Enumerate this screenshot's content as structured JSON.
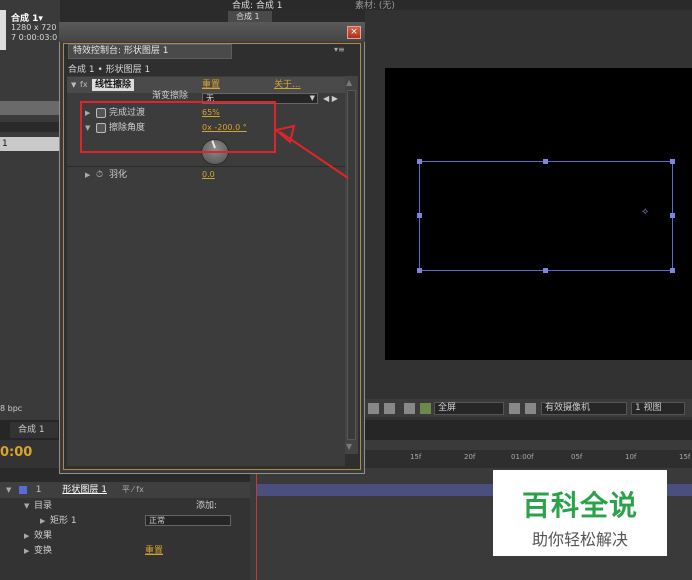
{
  "project": {
    "comp_name": "合成 1▾",
    "comp_size": "1280 x 720",
    "comp_duration": "7 0:00:03:0",
    "list_row": "1",
    "bpc": "8 bpc"
  },
  "composition": {
    "tab_label": "合成: 合成 1",
    "tab_label_2": "素材: (无)",
    "subtab": "合成 1",
    "toolbar": {
      "resolution": "全屏",
      "camera": "有效摄像机",
      "views": "1 视图"
    }
  },
  "effects_panel": {
    "close": "×",
    "tab_title": "特效控制台: 形状图层 1",
    "menu": "▾≡",
    "breadcrumb": "合成 1 • 形状图层 1",
    "effect_name": "线性擦除",
    "reset": "重置",
    "about": "关于...",
    "wipe_label": "渐变擦除",
    "wipe_value": "无",
    "params": [
      {
        "name": "完成过渡",
        "value": "65%"
      },
      {
        "name": "擦除角度",
        "value": "0x -200.0 °"
      }
    ],
    "feather": {
      "name": "羽化",
      "value": "0.0"
    }
  },
  "timeline": {
    "tab": "合成 1",
    "time": "0:00",
    "ruler": [
      "15f",
      "20f",
      "01:00f",
      "05f",
      "10f",
      "15f"
    ],
    "layer": {
      "number": "1",
      "name": "形状图层 1",
      "switches": "平 ⁄ fx"
    },
    "rows": [
      {
        "label": "目录",
        "extra": "添加:"
      },
      {
        "label": "矩形 1",
        "extra": "正常"
      },
      {
        "label": "效果",
        "extra": ""
      },
      {
        "label": "变换",
        "extra": "重置"
      }
    ]
  },
  "watermark": {
    "title": "百科全说",
    "subtitle": "助你轻松解决"
  }
}
